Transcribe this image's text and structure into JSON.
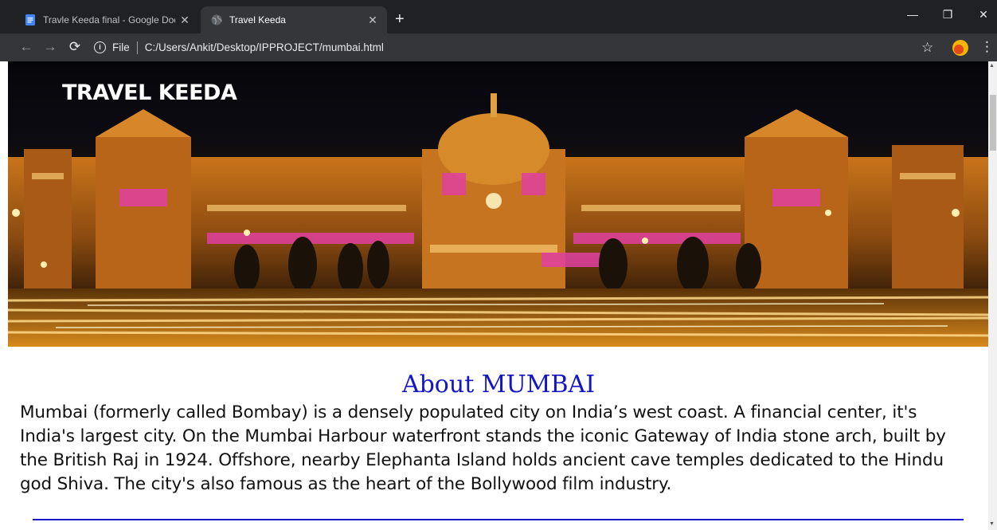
{
  "browser": {
    "tabs": [
      {
        "title": "Travle Keeda final - Google Docs",
        "active": false,
        "icon": "google-docs-icon"
      },
      {
        "title": "Travel Keeda",
        "active": true,
        "icon": "globe-icon"
      }
    ],
    "new_tab_label": "+",
    "address": {
      "scheme_label": "File",
      "url": "C:/Users/Ankit/Desktop/IPPROJECT/mumbai.html"
    },
    "colors": {
      "tabbar": "#202124",
      "toolbar": "#35363a"
    }
  },
  "page": {
    "brand": "TRAVEL KEEDA",
    "banner_image": "illuminated-railway-terminus-at-night",
    "about_title": "About MUMBAI",
    "about_text": "Mumbai (formerly called Bombay) is a densely populated city on India’s west coast. A financial center, it's India's largest city. On the Mumbai Harbour waterfront stands the iconic Gateway of India stone arch, built by the British Raj in 1924. Offshore, nearby Elephanta Island holds ancient cave temples dedicated to the Hindu god Shiva. The city's also famous as the heart of the Bollywood film industry.",
    "colors": {
      "title": "#1414c8",
      "divider": "#1a1acc"
    }
  }
}
